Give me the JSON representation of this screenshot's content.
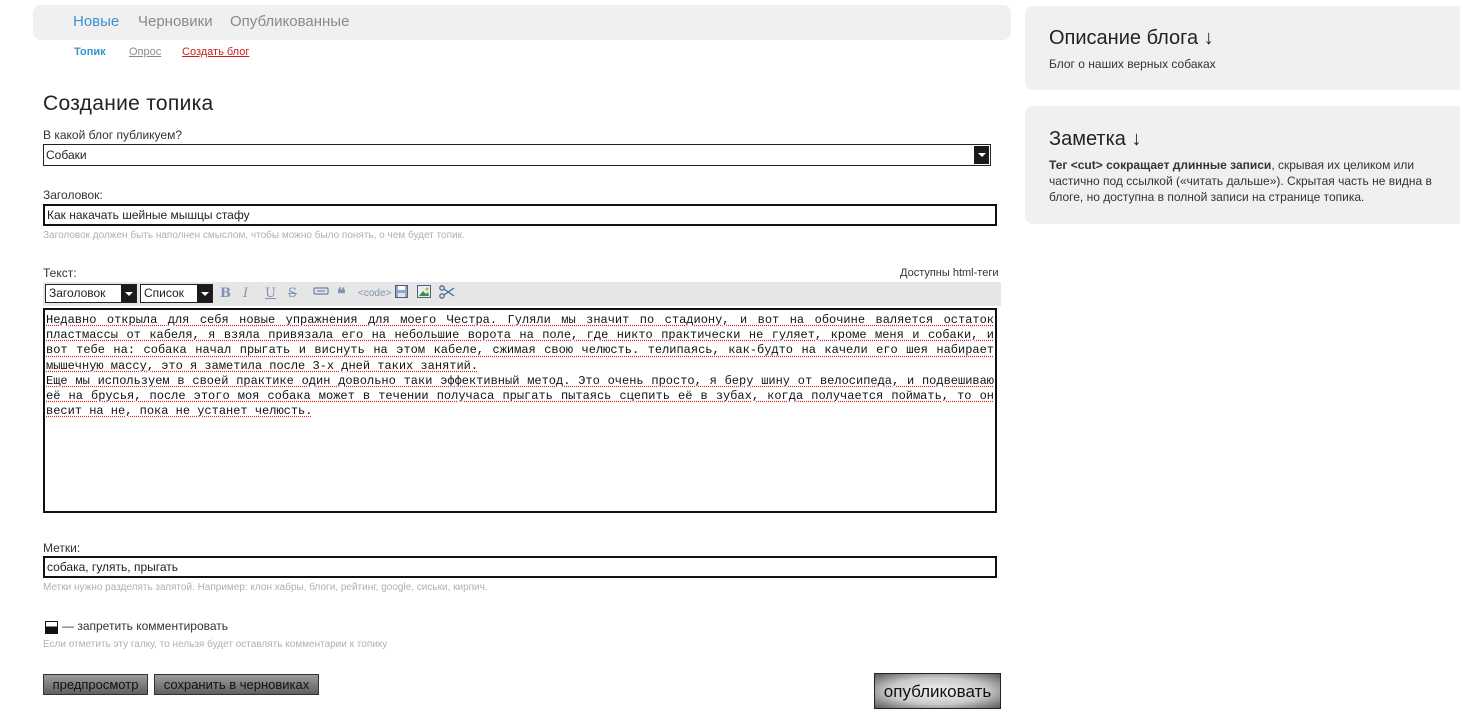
{
  "top_tabs": [
    "Новые",
    "Черновики",
    "Опубликованные"
  ],
  "sub_tabs": {
    "topic": "Топик",
    "poll": "Опрос",
    "create_blog": "Создать блог"
  },
  "page_title": "Создание топика",
  "blog_select": {
    "label": "В какой блог публикуем?",
    "value": "Собаки"
  },
  "title_field": {
    "label": "Заголовок:",
    "value": "Как накачать шейные мышцы стафу",
    "hint": "Заголовок должен быть наполнен смыслом, чтобы можно было понять, о чем будет топик."
  },
  "text_field": {
    "label": "Текст:",
    "html_note": "Доступны html-теги",
    "toolbar": {
      "heading_select": "Заголовок",
      "list_select": "Список",
      "bold": "B",
      "italic": "I",
      "underline": "U",
      "strike": "S",
      "code": "<code>"
    },
    "value_p1": "Недавно открыла для себя новые упражнения для моего Честра. Гуляли мы значит по стадиону, и вот на обочине валяется остаток пластмассы от кабеля, я взяла привязала его на небольшие ворота на поле, где никто практически не гуляет, кроме меня и собаки, и вот тебе на: собака начал прыгать и виснуть на этом кабеле, сжимая свою челюсть. телипаясь, как-будто на качели его шея набирает мышечную массу, это я заметила после 3-х дней таких занятий.",
    "value_p2": "Еще мы используем в своей практике один довольно таки эффективный метод. Это очень просто, я беру шину от велосипеда, и подвешиваю её на брусья, после этого моя собака может в течении получаса прыгать пытаясь сцепить её в зубах, когда получается поймать, то он весит на не, пока не устанет челюсть."
  },
  "tags_field": {
    "label": "Метки:",
    "value": "собака, гулять, прыгать",
    "hint": "Метки нужно разделять запятой. Например: клон хабры, блоги, рейтинг, google, сиськи, кирпич."
  },
  "forbid_comments": {
    "label": "— запретить комментировать",
    "hint": "Если отметить эту галку, то нельзя будет оставлять комментарии к топику"
  },
  "buttons": {
    "preview": "предпросмотр",
    "save_draft": "сохранить в черновиках",
    "publish": "опубликовать"
  },
  "sidebar": {
    "blog_desc_title": "Описание блога ↓",
    "blog_desc_text": "Блог о наших верных собаках",
    "note_title": "Заметка ↓",
    "note_bold": "Тег <cut> сокращает длинные записи",
    "note_rest": ", скрывая их целиком или частично под ссылкой («читать дальше»). Скрытая часть не видна в блоге, но доступна в полной записи на странице топика."
  }
}
